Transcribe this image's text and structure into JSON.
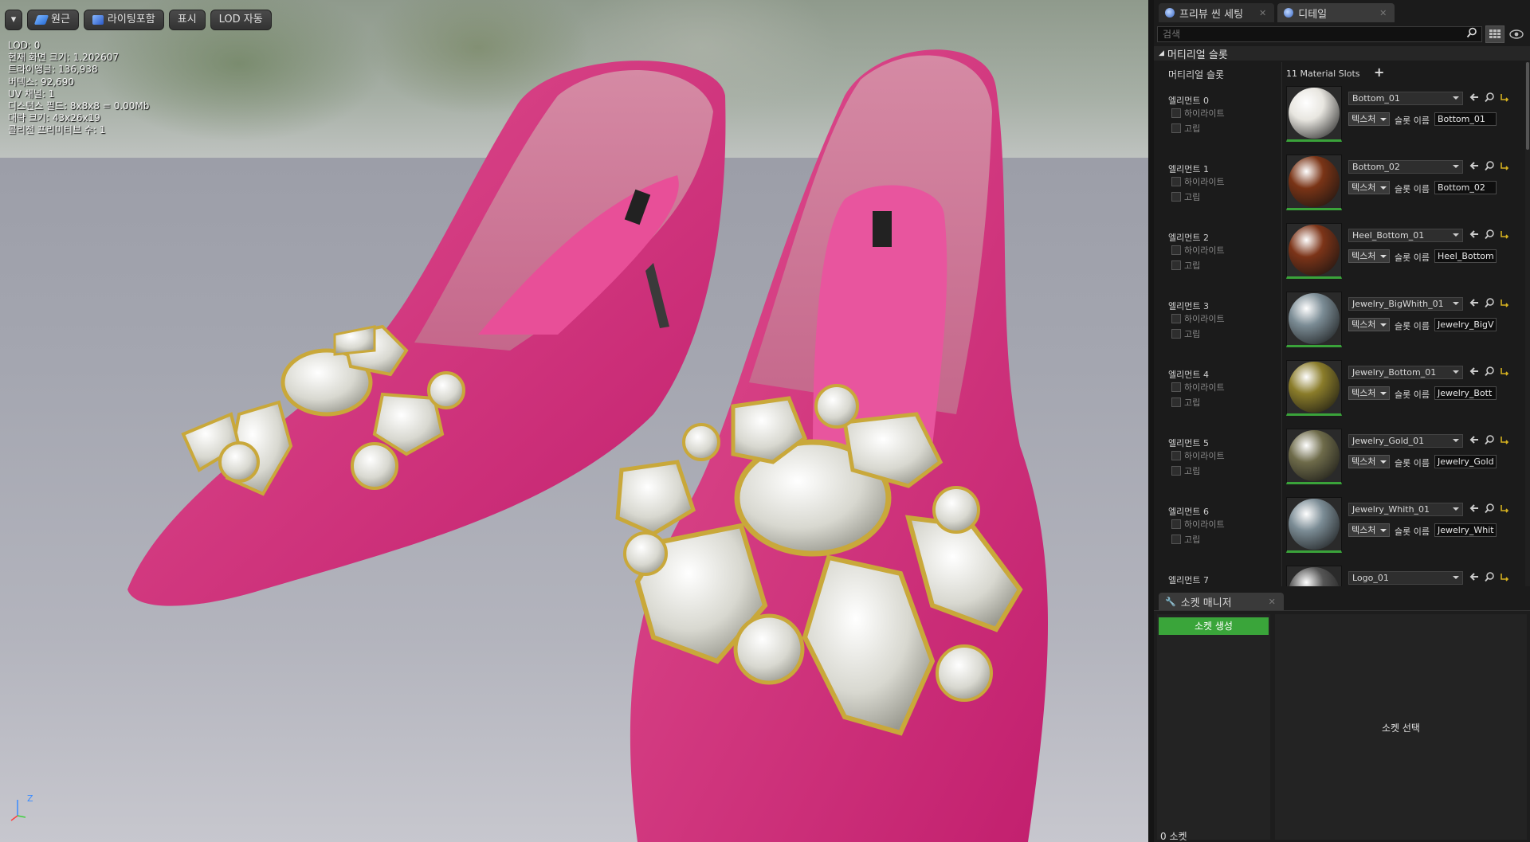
{
  "viewport": {
    "toolbar": {
      "menu_label": "▾",
      "perspective_label": "원근",
      "lighting_label": "라이팅포함",
      "show_label": "표시",
      "lod_label": "LOD 자동"
    },
    "stats": [
      "LOD:  0",
      "현재 화면 크기: 1.202607",
      "트라이앵글: 136,938",
      "버텍스: 92,690",
      "UV 채널:  1",
      "디스턴스 필드:  8x8x8 = 0.00Mb",
      "대략 크기: 43x26x19",
      "콜리전 프리미티브 수: 1"
    ],
    "axis": {
      "z": "Z"
    }
  },
  "panel": {
    "tabs": [
      {
        "label": "프리뷰 씬 세팅",
        "icon": "preview-scene-icon"
      },
      {
        "label": "디테일",
        "icon": "details-icon"
      }
    ],
    "search_placeholder": "검색",
    "section_title": "머티리얼 슬롯",
    "slots_label": "머티리얼 슬롯",
    "slots_value": "11 Material Slots",
    "highlight_label": "하이라이트",
    "isolate_label": "고립",
    "texture_label": "텍스처",
    "slot_name_label": "슬롯 이름",
    "elements": [
      {
        "name": "엘리먼트 0",
        "material": "Bottom_01",
        "slot": "Bottom_01",
        "color": "#e8e6e0"
      },
      {
        "name": "엘리먼트 1",
        "material": "Bottom_02",
        "slot": "Bottom_02",
        "color": "#7a3416"
      },
      {
        "name": "엘리먼트 2",
        "material": "Heel_Bottom_01",
        "slot": "Heel_Bottom",
        "color": "#7c3418"
      },
      {
        "name": "엘리먼트 3",
        "material": "Jewelry_BigWhith_01",
        "slot": "Jewelry_BigV",
        "color": "#7b8c95"
      },
      {
        "name": "엘리먼트 4",
        "material": "Jewelry_Bottom_01",
        "slot": "Jewelry_Bott",
        "color": "#8a7c2a"
      },
      {
        "name": "엘리먼트 5",
        "material": "Jewelry_Gold_01",
        "slot": "Jewelry_Gold",
        "color": "#6e6b4a"
      },
      {
        "name": "엘리먼트 6",
        "material": "Jewelry_Whith_01",
        "slot": "Jewelry_Whit",
        "color": "#7b8c95"
      },
      {
        "name": "엘리먼트 7",
        "material": "Logo_01",
        "slot": "",
        "color": "#555555"
      }
    ],
    "socket": {
      "tab_label": "소켓 매니저",
      "create_label": "소켓 생성",
      "count_label": "0 소켓",
      "select_label": "소켓 선택"
    }
  }
}
